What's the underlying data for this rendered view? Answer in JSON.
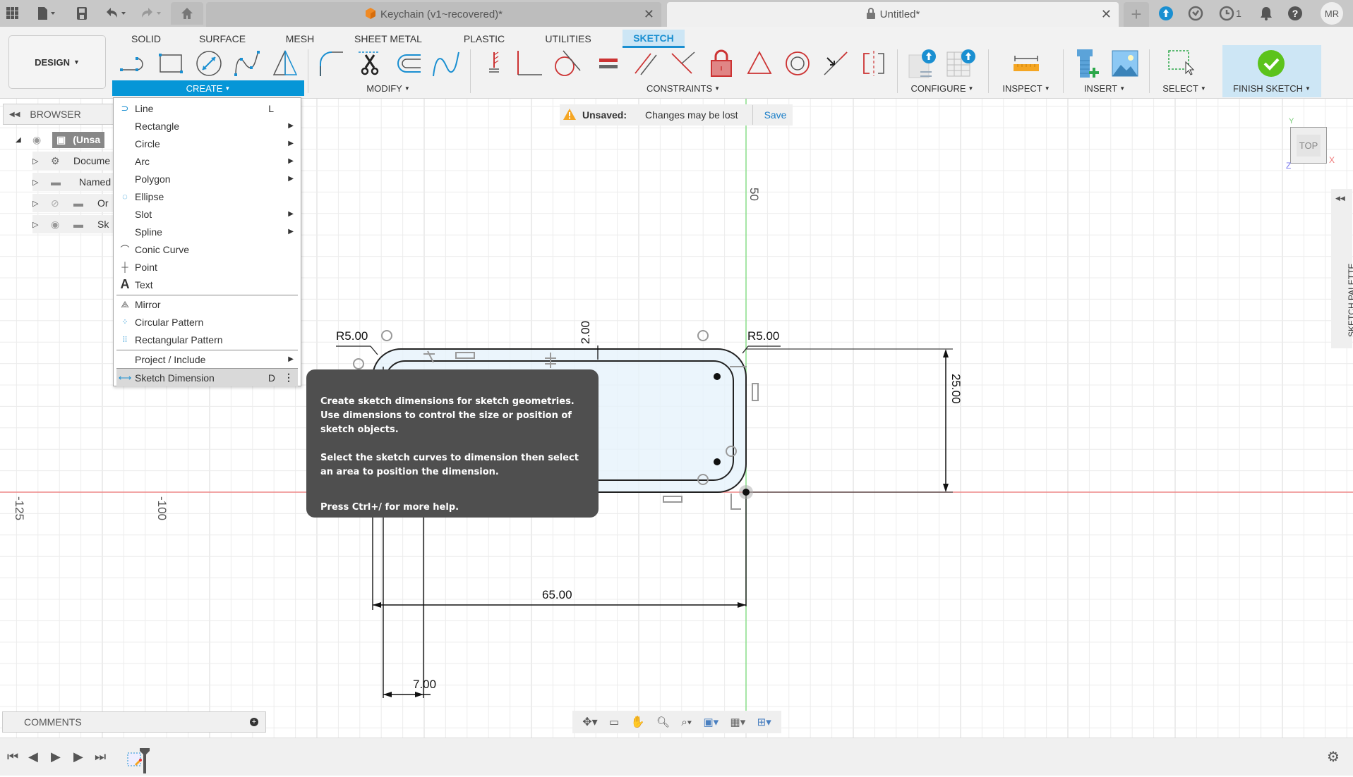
{
  "titlebar": {
    "tabs": [
      {
        "label": "Keychain (v1~recovered)*",
        "icon": "orange-cube-icon"
      },
      {
        "label": "Untitled*",
        "icon": "lock-icon"
      }
    ],
    "job_count": "1",
    "user_initials": "MR"
  },
  "toolbar": {
    "workspace": "DESIGN",
    "tabs": [
      "SOLID",
      "SURFACE",
      "MESH",
      "SHEET METAL",
      "PLASTIC",
      "UTILITIES",
      "SKETCH"
    ],
    "active_tab": "SKETCH",
    "groups": [
      "CREATE",
      "MODIFY",
      "CONSTRAINTS",
      "CONFIGURE",
      "INSPECT",
      "INSERT",
      "SELECT",
      "FINISH SKETCH"
    ]
  },
  "browser": {
    "title": "BROWSER",
    "items": [
      {
        "label": "(Unsa"
      },
      {
        "label": "Docume"
      },
      {
        "label": "Named"
      },
      {
        "label": "Or"
      },
      {
        "label": "Sk"
      }
    ]
  },
  "create_menu": {
    "items": [
      {
        "label": "Line",
        "shortcut": "L",
        "submenu": false
      },
      {
        "label": "Rectangle",
        "submenu": true
      },
      {
        "label": "Circle",
        "submenu": true
      },
      {
        "label": "Arc",
        "submenu": true
      },
      {
        "label": "Polygon",
        "submenu": true
      },
      {
        "label": "Ellipse",
        "submenu": false
      },
      {
        "label": "Slot",
        "submenu": true
      },
      {
        "label": "Spline",
        "submenu": true
      },
      {
        "label": "Conic Curve",
        "submenu": false
      },
      {
        "label": "Point",
        "submenu": false
      },
      {
        "label": "Text",
        "submenu": false
      },
      {
        "label": "Mirror",
        "submenu": false
      },
      {
        "label": "Circular Pattern",
        "submenu": false
      },
      {
        "label": "Rectangular Pattern",
        "submenu": false
      },
      {
        "label": "Project / Include",
        "submenu": true
      },
      {
        "label": "Sketch Dimension",
        "shortcut": "D",
        "highlighted": true
      }
    ]
  },
  "tooltip": {
    "p1": "Create sketch dimensions for sketch geometries. Use dimensions to control the size or position of sketch objects.",
    "p2": "Select the sketch curves to dimension then select an area to position the dimension.",
    "p3": "Press Ctrl+/ for more help."
  },
  "unsaved_banner": {
    "label": "Unsaved:",
    "message": "Changes may be lost",
    "save": "Save"
  },
  "sketch": {
    "dimensions": {
      "radius_left": "R5.00",
      "radius_right": "R5.00",
      "offset": "2.00",
      "height": "25.00",
      "width": "65.00",
      "hole": "7.00"
    },
    "axis_labels": {
      "y50": "50",
      "x_neg125": "-125",
      "x_neg100": "-100"
    }
  },
  "viewcube": {
    "face": "TOP",
    "x": "X",
    "y": "Y",
    "z": "Z"
  },
  "sketch_palette": {
    "label": "SKETCH PALETTE"
  },
  "comments": {
    "label": "COMMENTS"
  }
}
